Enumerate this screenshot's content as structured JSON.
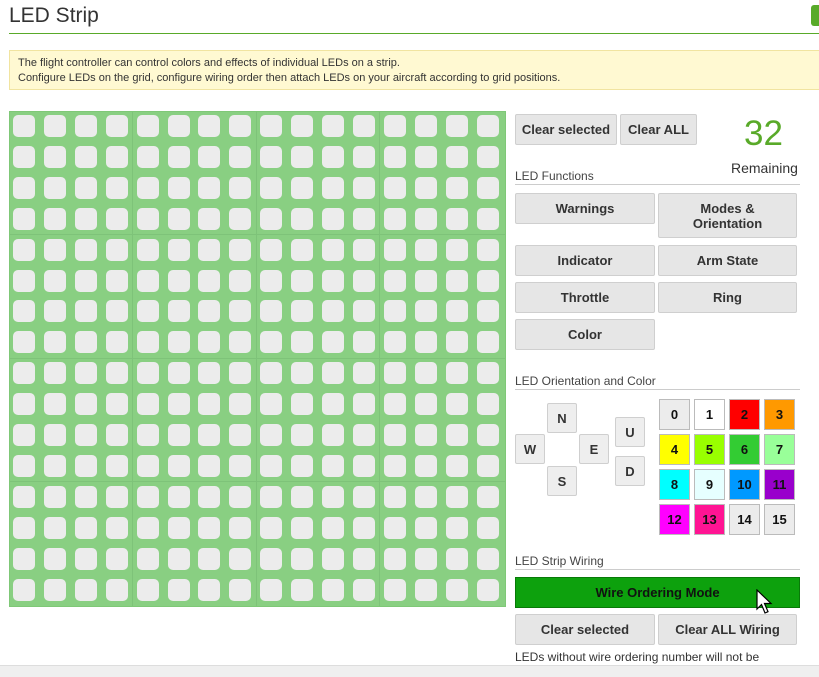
{
  "page": {
    "title": "LED Strip",
    "note_line1": "The flight controller can control colors and effects of individual LEDs on a strip.",
    "note_line2": "Configure LEDs on the grid, configure wiring order then attach LEDs on your aircraft according to grid positions."
  },
  "controls": {
    "clear_selected": "Clear selected",
    "clear_all": "Clear ALL",
    "remaining_count": "32",
    "remaining_label": "Remaining"
  },
  "functions": {
    "heading": "LED Functions",
    "warnings": "Warnings",
    "modes": "Modes & Orientation",
    "indicator": "Indicator",
    "arm_state": "Arm State",
    "throttle": "Throttle",
    "ring": "Ring",
    "color": "Color"
  },
  "orientation": {
    "heading": "LED Orientation and Color",
    "n": "N",
    "w": "W",
    "e": "E",
    "s": "S",
    "u": "U",
    "d": "D"
  },
  "colors": [
    {
      "label": "0",
      "bg": "#ececec",
      "fg": "#111111"
    },
    {
      "label": "1",
      "bg": "#ffffff",
      "fg": "#111111"
    },
    {
      "label": "2",
      "bg": "#ff0000",
      "fg": "#111111"
    },
    {
      "label": "3",
      "bg": "#ff9900",
      "fg": "#111111"
    },
    {
      "label": "4",
      "bg": "#ffff00",
      "fg": "#111111"
    },
    {
      "label": "5",
      "bg": "#99ff00",
      "fg": "#111111"
    },
    {
      "label": "6",
      "bg": "#33cc33",
      "fg": "#111111"
    },
    {
      "label": "7",
      "bg": "#99ff99",
      "fg": "#111111"
    },
    {
      "label": "8",
      "bg": "#00ffff",
      "fg": "#111111"
    },
    {
      "label": "9",
      "bg": "#e6ffff",
      "fg": "#111111"
    },
    {
      "label": "10",
      "bg": "#0099ff",
      "fg": "#111111"
    },
    {
      "label": "11",
      "bg": "#9900cc",
      "fg": "#111111"
    },
    {
      "label": "12",
      "bg": "#ff00ff",
      "fg": "#111111"
    },
    {
      "label": "13",
      "bg": "#ff1493",
      "fg": "#111111"
    },
    {
      "label": "14",
      "bg": "#ececec",
      "fg": "#111111"
    },
    {
      "label": "15",
      "bg": "#ececec",
      "fg": "#111111"
    }
  ],
  "wiring": {
    "heading": "LED Strip Wiring",
    "mode_button": "Wire Ordering Mode",
    "clear_selected": "Clear selected",
    "clear_all": "Clear ALL Wiring",
    "footnote": "LEDs without wire ordering number will not be"
  },
  "grid": {
    "rows": 16,
    "cols": 16
  },
  "theme": {
    "accent": "#59aa29",
    "grid_bg": "#89cf82",
    "wire_mode_bg": "#0da10d"
  }
}
